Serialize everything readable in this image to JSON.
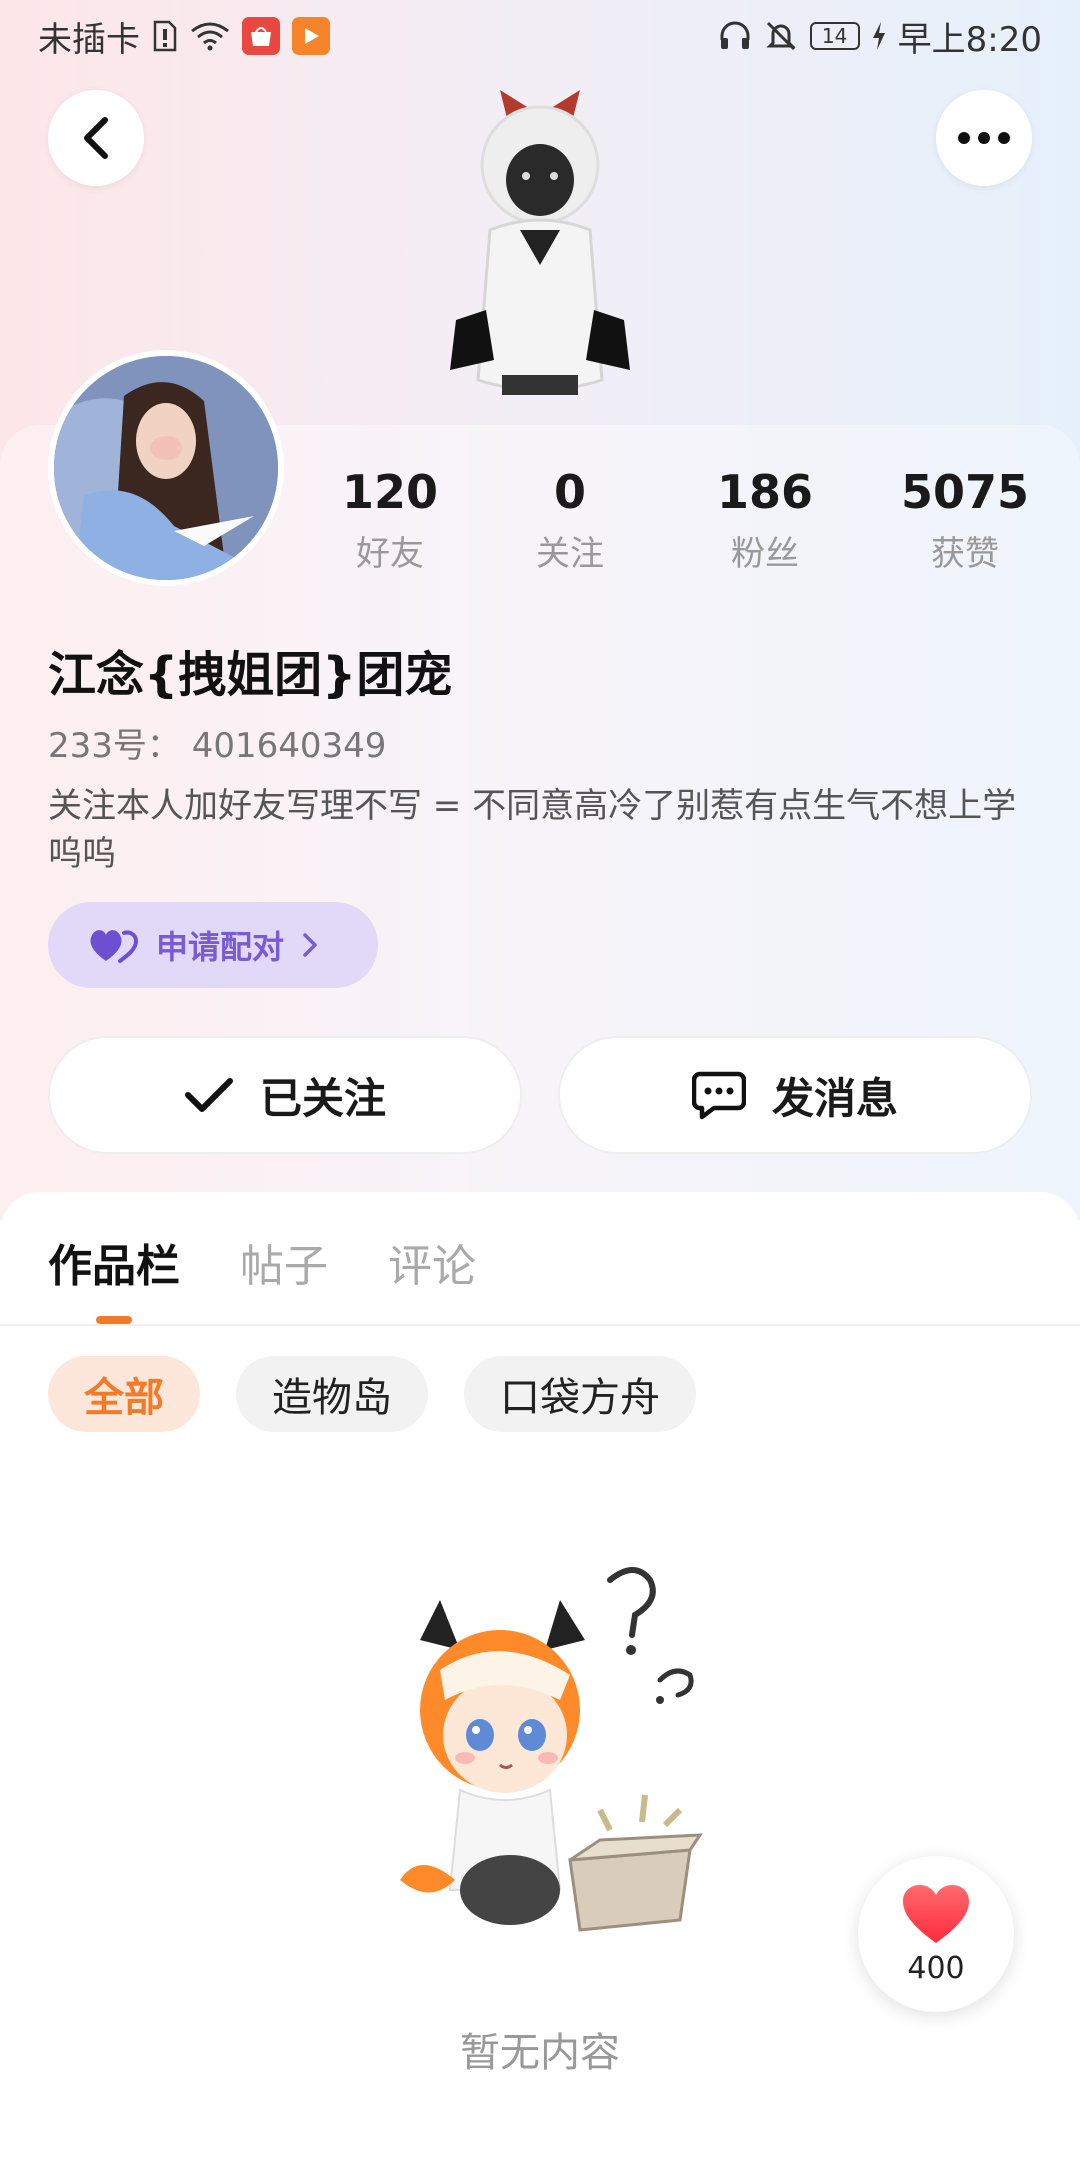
{
  "status_bar": {
    "carrier": "未插卡",
    "time": "早上8:20",
    "battery": "14",
    "app_badges": [
      "HUAWEI",
      "play"
    ]
  },
  "header": {
    "back_icon": "chevron-left-icon",
    "more_icon": "more-dots-icon"
  },
  "profile": {
    "stats": [
      {
        "value": "120",
        "label": "好友"
      },
      {
        "value": "0",
        "label": "关注"
      },
      {
        "value": "186",
        "label": "粉丝"
      },
      {
        "value": "5075",
        "label": "获赞"
      }
    ],
    "nickname": "江念{拽姐团}团宠",
    "uid": "233号：  401640349",
    "bio": "关注本人加好友写理不写 = 不同意高冷了别惹有点生气不想上学呜呜",
    "match_button": "申请配对",
    "follow_button": "已关注",
    "message_button": "发消息"
  },
  "tabs": [
    {
      "label": "作品栏",
      "active": true
    },
    {
      "label": "帖子",
      "active": false
    },
    {
      "label": "评论",
      "active": false
    }
  ],
  "filters": [
    {
      "label": "全部",
      "active": true
    },
    {
      "label": "造物岛",
      "active": false
    },
    {
      "label": "口袋方舟",
      "active": false
    }
  ],
  "empty_state": {
    "text": "暂无内容"
  },
  "likes_fab": {
    "count": "400"
  },
  "colors": {
    "accent": "#f27b2a",
    "match_purple": "#7a5bd6",
    "heart_red": "#ff3b4a"
  }
}
